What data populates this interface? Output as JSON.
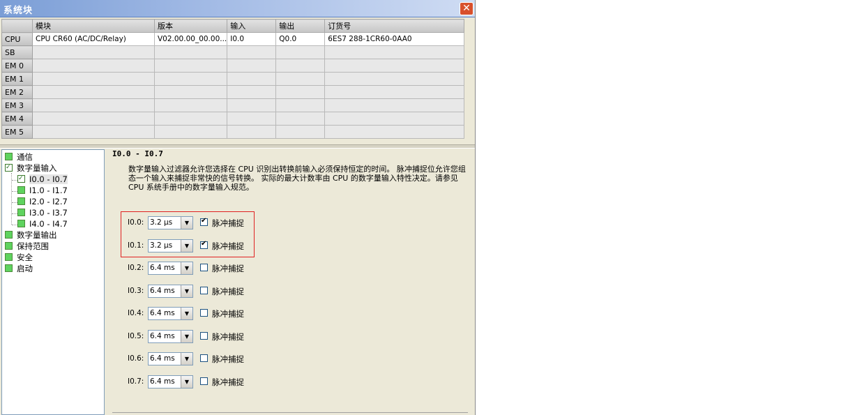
{
  "window": {
    "title": "系统块",
    "close_glyph": "✕"
  },
  "grid": {
    "columns": [
      "",
      "模块",
      "版本",
      "输入",
      "输出",
      "订货号"
    ],
    "rows": [
      [
        "CPU",
        "CPU CR60 (AC/DC/Relay)",
        "V02.00.00_00.00...",
        "I0.0",
        "Q0.0",
        "6ES7 288-1CR60-0AA0"
      ],
      [
        "SB",
        "",
        "",
        "",
        "",
        ""
      ],
      [
        "EM 0",
        "",
        "",
        "",
        "",
        ""
      ],
      [
        "EM 1",
        "",
        "",
        "",
        "",
        ""
      ],
      [
        "EM 2",
        "",
        "",
        "",
        "",
        ""
      ],
      [
        "EM 3",
        "",
        "",
        "",
        "",
        ""
      ],
      [
        "EM 4",
        "",
        "",
        "",
        "",
        ""
      ],
      [
        "EM 5",
        "",
        "",
        "",
        "",
        ""
      ]
    ]
  },
  "tree": {
    "comm": "通信",
    "di": "数字量输入",
    "di_children": [
      "I0.0 - I0.7",
      "I1.0 - I1.7",
      "I2.0 - I2.7",
      "I3.0 - I3.7",
      "I4.0 - I4.7"
    ],
    "do": "数字量输出",
    "retain": "保持范围",
    "security": "安全",
    "startup": "启动"
  },
  "panel": {
    "heading": "I0.0 - I0.7",
    "description": "数字量输入过滤器允许您选择在 CPU 识别出转换前输入必须保持恒定的时间。 脉冲捕捉位允许您组态一个输入来捕捉非常快的信号转换。 实际的最大计数率由 CPU 的数字量输入特性决定。请参见 CPU 系统手册中的数字量输入规范。",
    "checkbox_label": "脉冲捕捉",
    "inputs": [
      {
        "label": "I0.0:",
        "filter": "3.2 µs",
        "pulse_catch": true
      },
      {
        "label": "I0.1:",
        "filter": "3.2 µs",
        "pulse_catch": true
      },
      {
        "label": "I0.2:",
        "filter": "6.4 ms",
        "pulse_catch": false
      },
      {
        "label": "I0.3:",
        "filter": "6.4 ms",
        "pulse_catch": false
      },
      {
        "label": "I0.4:",
        "filter": "6.4 ms",
        "pulse_catch": false
      },
      {
        "label": "I0.5:",
        "filter": "6.4 ms",
        "pulse_catch": false
      },
      {
        "label": "I0.6:",
        "filter": "6.4 ms",
        "pulse_catch": false
      },
      {
        "label": "I0.7:",
        "filter": "6.4 ms",
        "pulse_catch": false
      }
    ]
  },
  "colors": {
    "highlight_box": "#e02020",
    "tree_box": "#5fd35f"
  }
}
